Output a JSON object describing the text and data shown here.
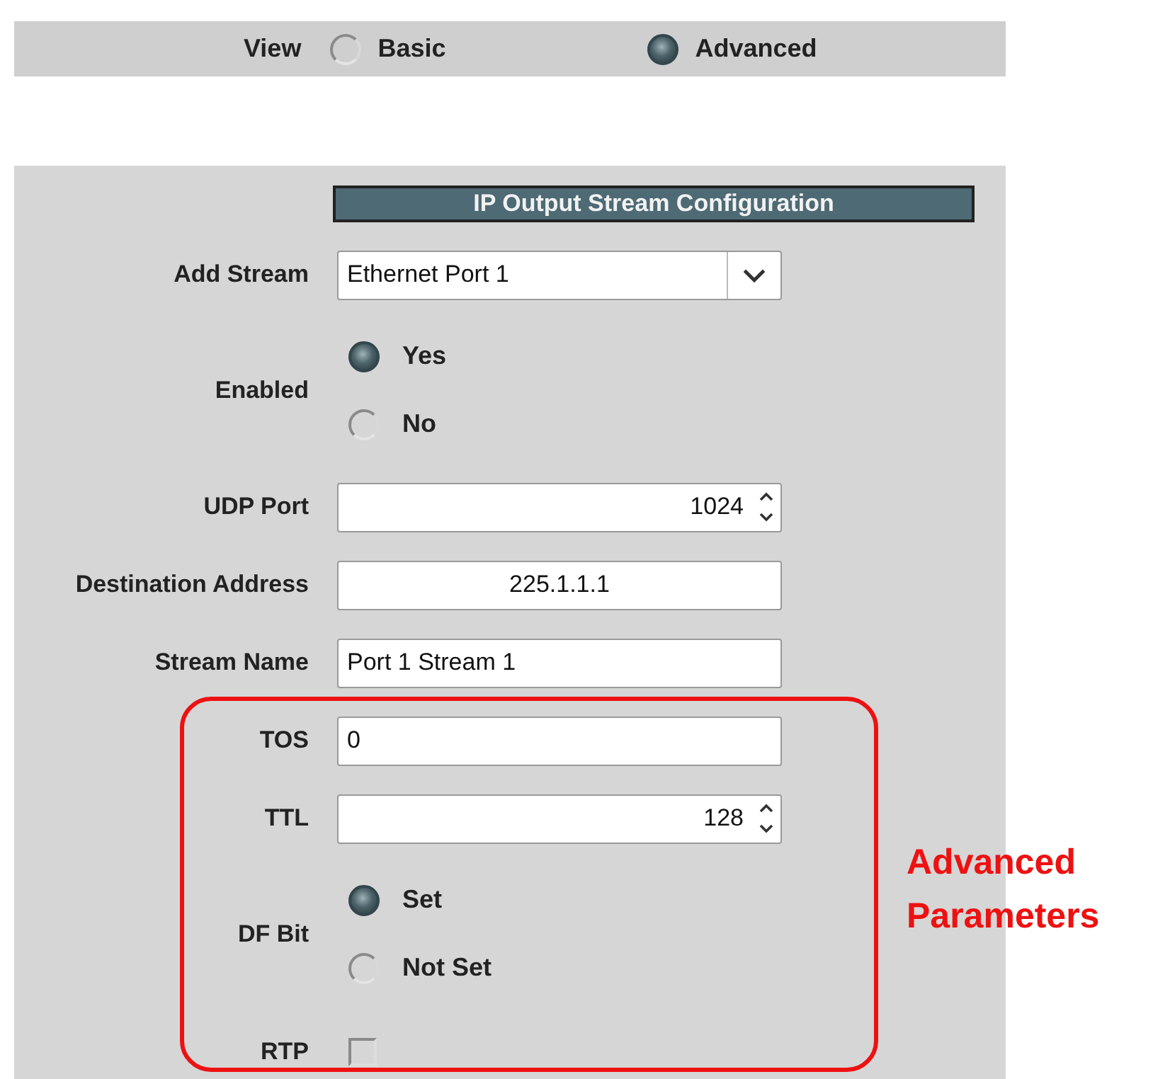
{
  "view": {
    "label": "View",
    "options": [
      {
        "label": "Basic",
        "selected": false
      },
      {
        "label": "Advanced",
        "selected": true
      }
    ]
  },
  "panel": {
    "title": "IP Output Stream Configuration",
    "fields": [
      {
        "kind": "select",
        "label": "Add Stream",
        "value": "Ethernet Port 1"
      },
      {
        "kind": "radio",
        "label": "Enabled",
        "options": [
          {
            "label": "Yes",
            "selected": true
          },
          {
            "label": "No",
            "selected": false
          }
        ]
      },
      {
        "kind": "spin",
        "label": "UDP Port",
        "value": "1024"
      },
      {
        "kind": "centered",
        "label": "Destination Address",
        "value": "225.1.1.1"
      },
      {
        "kind": "text",
        "label": "Stream Name",
        "value": "Port 1 Stream 1"
      },
      {
        "kind": "text",
        "label": "TOS",
        "value": "0"
      },
      {
        "kind": "spin",
        "label": "TTL",
        "value": "128"
      },
      {
        "kind": "radio",
        "label": "DF Bit",
        "options": [
          {
            "label": "Set",
            "selected": true
          },
          {
            "label": "Not Set",
            "selected": false
          }
        ]
      },
      {
        "kind": "checkbox",
        "label": "RTP",
        "checked": false
      }
    ]
  },
  "annotation": {
    "text": "Advanced Parameters"
  }
}
